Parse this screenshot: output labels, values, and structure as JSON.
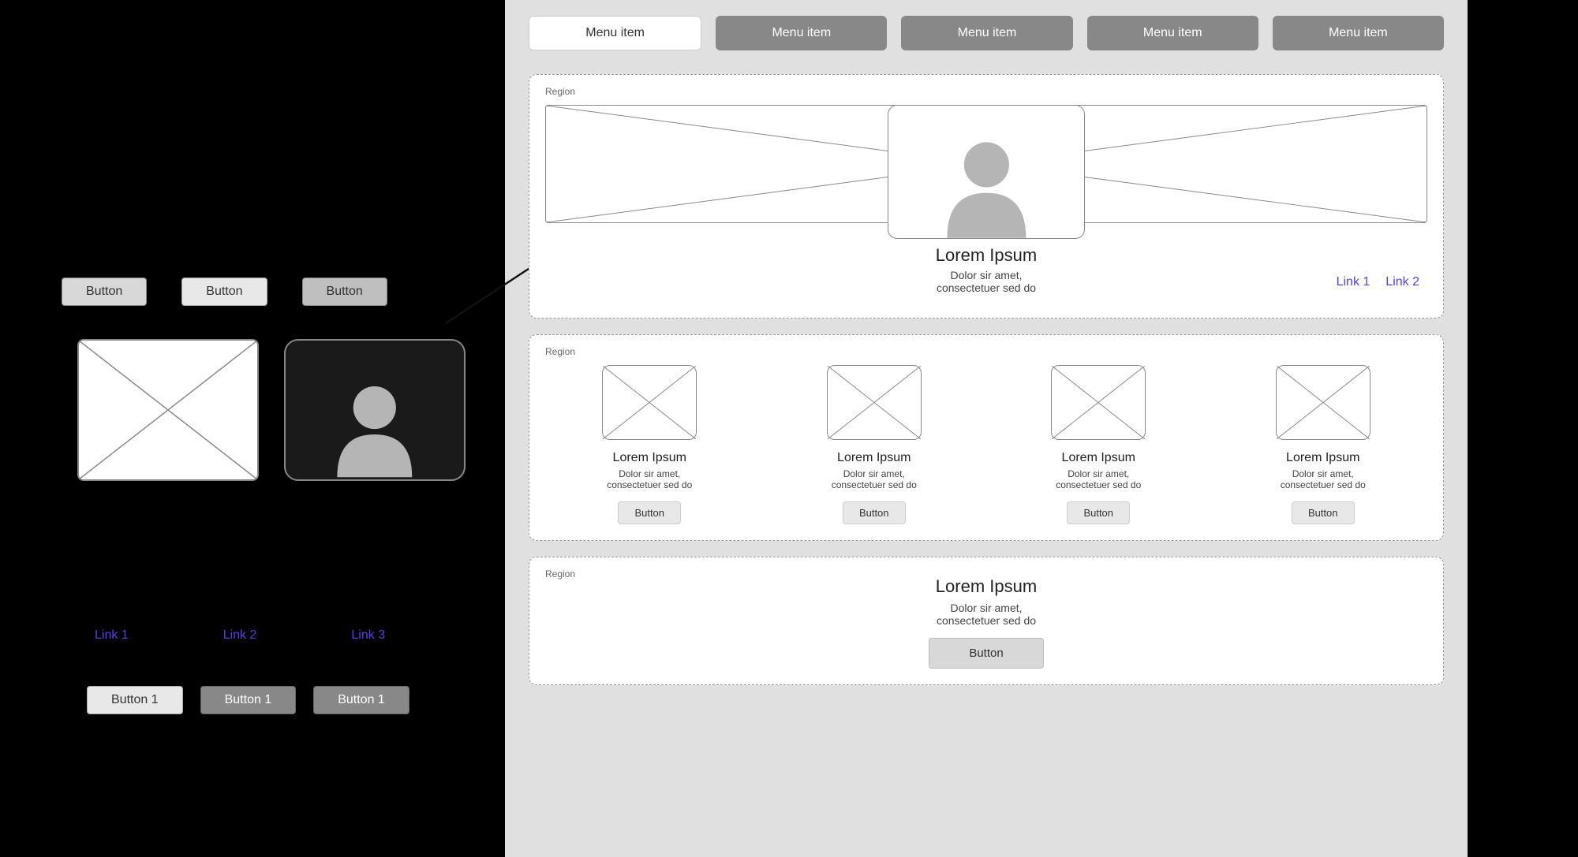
{
  "left": {
    "row1_buttons": [
      "Button",
      "Button",
      "Button"
    ],
    "links": [
      "Link 1",
      "Link 2",
      "Link 3"
    ],
    "row3_buttons": [
      "Button 1",
      "Button 1",
      "Button 1"
    ]
  },
  "right": {
    "menu": [
      "Menu item",
      "Menu item",
      "Menu item",
      "Menu item",
      "Menu item"
    ],
    "region_label": "Region",
    "hero": {
      "title": "Lorem Ipsum",
      "subtitle": "Dolor sir amet,\nconsectetuer sed do",
      "links": [
        "Link 1",
        "Link 2"
      ]
    },
    "cards": [
      {
        "title": "Lorem Ipsum",
        "subtitle": "Dolor sir amet,\nconsectetuer sed do",
        "button": "Button"
      },
      {
        "title": "Lorem Ipsum",
        "subtitle": "Dolor sir amet,\nconsectetuer sed do",
        "button": "Button"
      },
      {
        "title": "Lorem Ipsum",
        "subtitle": "Dolor sir amet,\nconsectetuer sed do",
        "button": "Button"
      },
      {
        "title": "Lorem Ipsum",
        "subtitle": "Dolor sir amet,\nconsectetuer sed do",
        "button": "Button"
      }
    ],
    "cta": {
      "title": "Lorem Ipsum",
      "subtitle": "Dolor sir amet,\nconsectetuer sed do",
      "button": "Button"
    }
  },
  "colors": {
    "link": "#5a3de8"
  }
}
